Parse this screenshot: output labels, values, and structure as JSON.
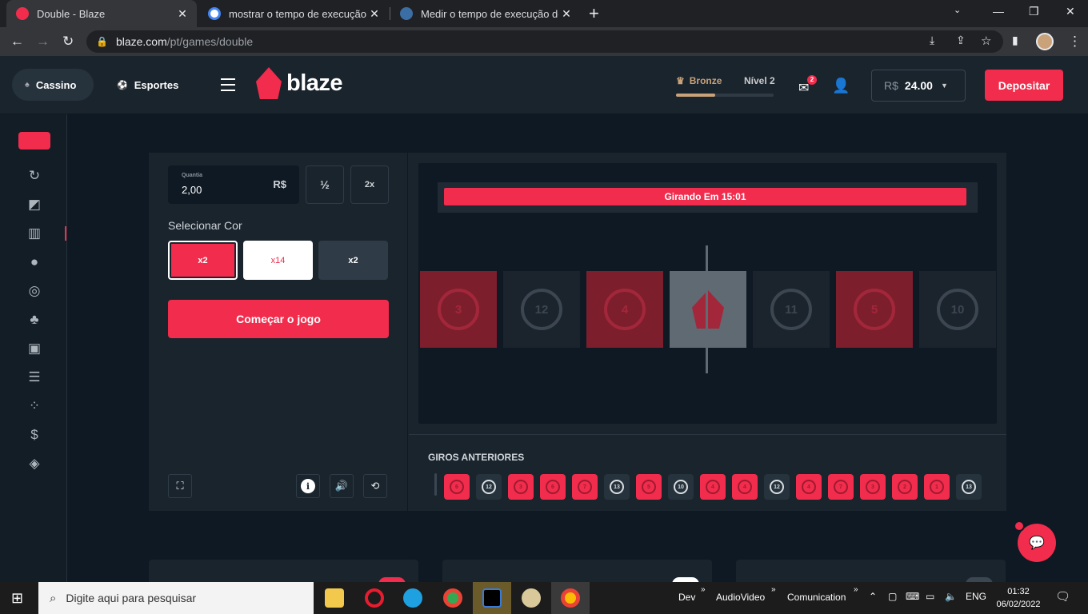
{
  "browser": {
    "tabs": [
      {
        "title": "Double - Blaze",
        "favicon_color": "#f12c4c"
      },
      {
        "title": "mostrar o tempo de execução jav",
        "favicon_color": "#4285f4"
      },
      {
        "title": "Medir o tempo de execução de u",
        "favicon_color": "#3b6ea5"
      }
    ],
    "url_domain": "blaze.com",
    "url_path": "/pt/games/double"
  },
  "header": {
    "casino_label": "Cassino",
    "esportes_label": "Esportes",
    "logo_text": "blaze",
    "rank": "Bronze",
    "level": "Nível 2",
    "xp_progress": 0.4,
    "mail_count": "2",
    "balance_currency": "R$",
    "balance_amount": "24.00",
    "deposit_label": "Depositar"
  },
  "controls": {
    "amount_label": "Quantia",
    "amount_value": "2,00",
    "amount_currency": "R$",
    "half_label": "½",
    "double_label": "2x",
    "select_color_label": "Selecionar Cor",
    "colors": [
      {
        "label": "x2",
        "color": "red"
      },
      {
        "label": "x14",
        "color": "white"
      },
      {
        "label": "x2",
        "color": "black"
      }
    ],
    "start_label": "Começar o jogo",
    "info_icon": "i"
  },
  "board": {
    "timer_text": "Girando Em 15:01",
    "tiles": [
      {
        "color": "red",
        "number": "3"
      },
      {
        "color": "black",
        "number": "12"
      },
      {
        "color": "red",
        "number": "4"
      },
      {
        "color": "white",
        "number": ""
      },
      {
        "color": "black",
        "number": "11"
      },
      {
        "color": "red",
        "number": "5"
      },
      {
        "color": "black",
        "number": "10"
      }
    ]
  },
  "history": {
    "label": "GIROS ANTERIORES",
    "results": [
      {
        "color": "red",
        "number": "6"
      },
      {
        "color": "black",
        "number": "12"
      },
      {
        "color": "red",
        "number": "3"
      },
      {
        "color": "red",
        "number": "6"
      },
      {
        "color": "red",
        "number": "7"
      },
      {
        "color": "black",
        "number": "13"
      },
      {
        "color": "red",
        "number": "5"
      },
      {
        "color": "black",
        "number": "10"
      },
      {
        "color": "red",
        "number": "4"
      },
      {
        "color": "red",
        "number": "4"
      },
      {
        "color": "black",
        "number": "12"
      },
      {
        "color": "red",
        "number": "4"
      },
      {
        "color": "red",
        "number": "7"
      },
      {
        "color": "red",
        "number": "3"
      },
      {
        "color": "red",
        "number": "2"
      },
      {
        "color": "red",
        "number": "1"
      },
      {
        "color": "black",
        "number": "13"
      }
    ]
  },
  "taskbar": {
    "search_placeholder": "Digite aqui para pesquisar",
    "toolbars": [
      "Dev",
      "AudioVideo",
      "Comunication"
    ],
    "language": "ENG",
    "time": "01:32",
    "date": "06/02/2022"
  },
  "colors": {
    "accent": "#f12c4c",
    "background": "#0f1923",
    "panel": "#1a242d"
  }
}
